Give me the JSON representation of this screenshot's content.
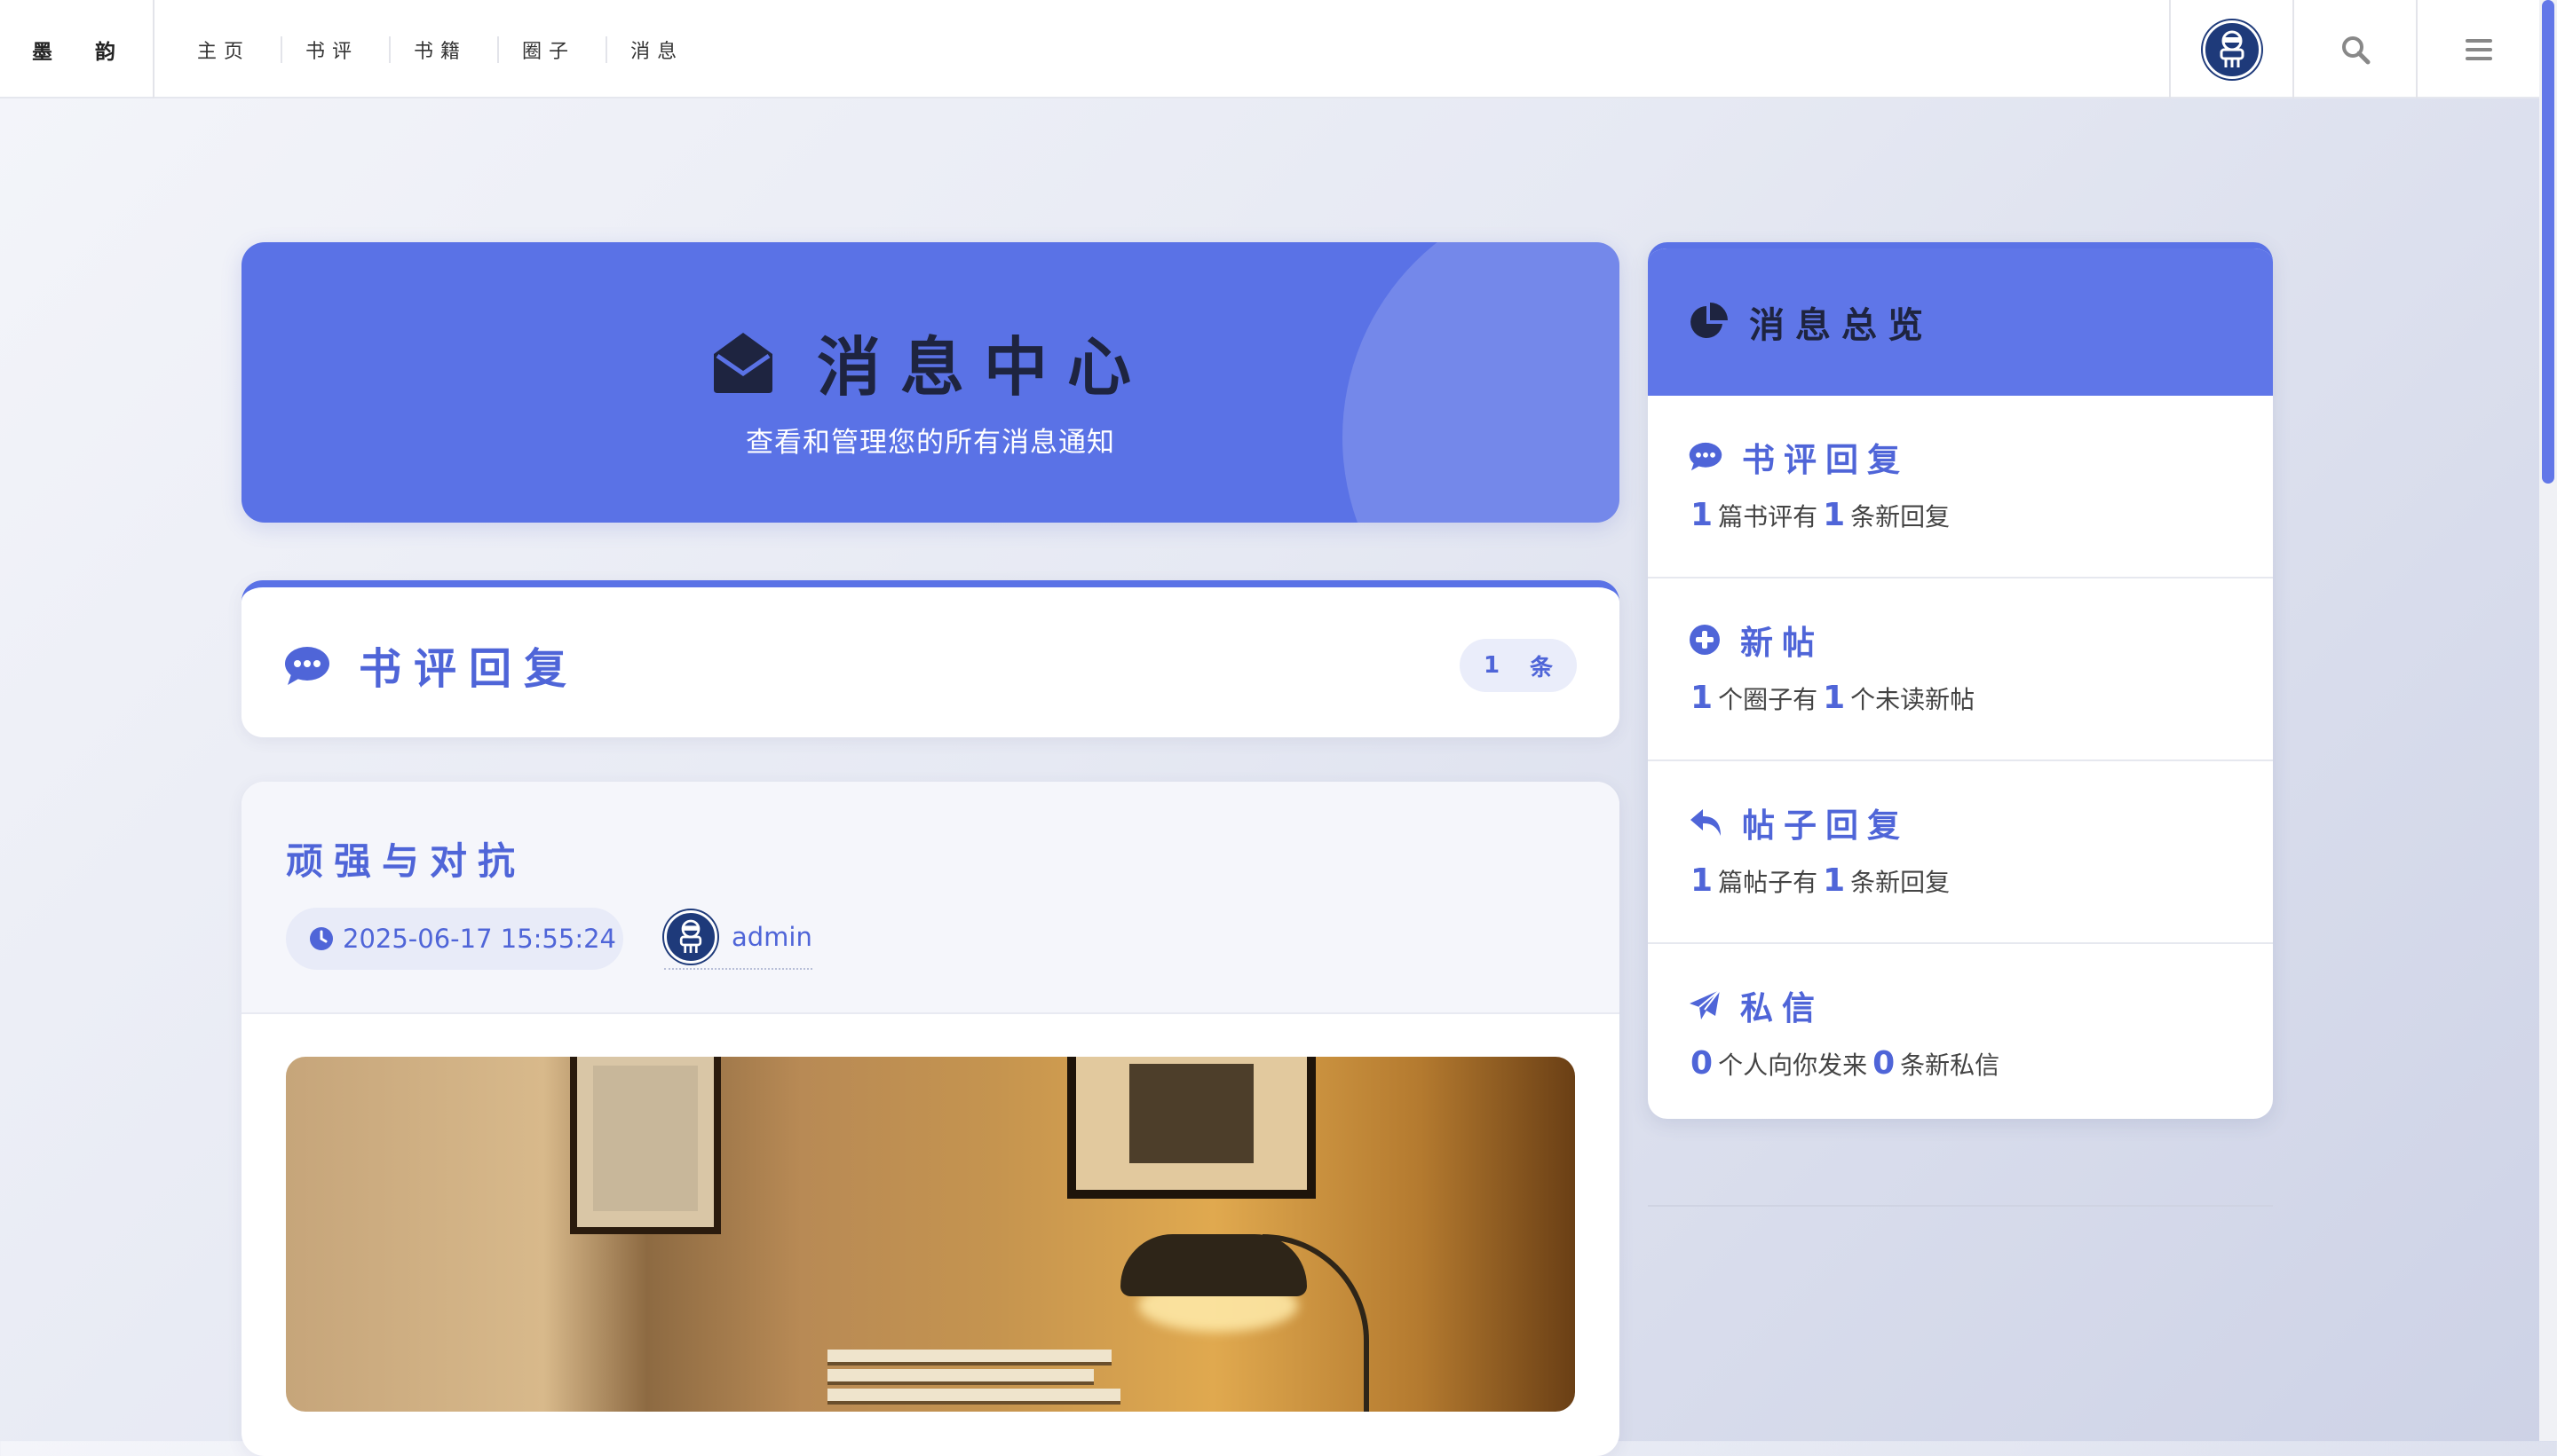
{
  "navbar": {
    "brand": "墨 韵",
    "links": [
      "主页",
      "书评",
      "书籍",
      "圈子",
      "消息"
    ],
    "avatar_icon": "robot-avatar-icon",
    "search_icon": "search-icon",
    "menu_icon": "hamburger-menu-icon"
  },
  "hero": {
    "icon": "envelope-open-icon",
    "title": "消息中心",
    "subtitle": "查看和管理您的所有消息通知"
  },
  "section": {
    "icon": "comment-dots-icon",
    "title": "书评回复",
    "count": "1",
    "count_unit": "条"
  },
  "post": {
    "title": "顽强与对抗",
    "time_icon": "clock-icon",
    "time": "2025-06-17 15:55:24",
    "author": "admin",
    "image_desc": "lamp-books-photo"
  },
  "sidebar": {
    "icon": "pie-chart-icon",
    "title": "消息总览",
    "items": [
      {
        "icon": "comment-dots-icon",
        "title": "书评回复",
        "n1": "1",
        "t1": "篇书评有",
        "n2": "1",
        "t2": "条新回复"
      },
      {
        "icon": "plus-circle-icon",
        "title": "新帖",
        "n1": "1",
        "t1": "个圈子有",
        "n2": "1",
        "t2": "个未读新帖"
      },
      {
        "icon": "reply-icon",
        "title": "帖子回复",
        "n1": "1",
        "t1": "篇帖子有",
        "n2": "1",
        "t2": "条新回复"
      },
      {
        "icon": "paper-plane-icon",
        "title": "私信",
        "n1": "0",
        "t1": "个人向你发来",
        "n2": "0",
        "t2": "条新私信"
      }
    ]
  },
  "colors": {
    "accent": "#5a72e6",
    "accent_text": "#4f65d8",
    "dark": "#1e2440"
  }
}
